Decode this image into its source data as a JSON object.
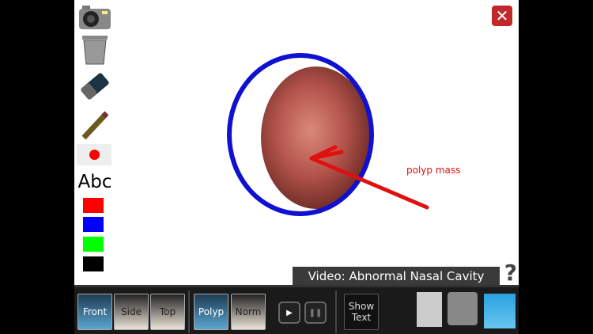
{
  "tools": {
    "abc": "Abc",
    "colors": [
      "#ff0000",
      "#0000ff",
      "#00ff00",
      "#000000"
    ]
  },
  "close": "✕",
  "annotation": "polyp mass",
  "video_label": "Video: Abnormal Nasal Cavity",
  "help": "?",
  "toolbar": {
    "front": "Front",
    "side": "Side",
    "top": "Top",
    "polyp": "Polyp",
    "norm": "Norm",
    "play": "▶",
    "pause": "❚❚",
    "show_text_1": "Show",
    "show_text_2": "Text"
  }
}
